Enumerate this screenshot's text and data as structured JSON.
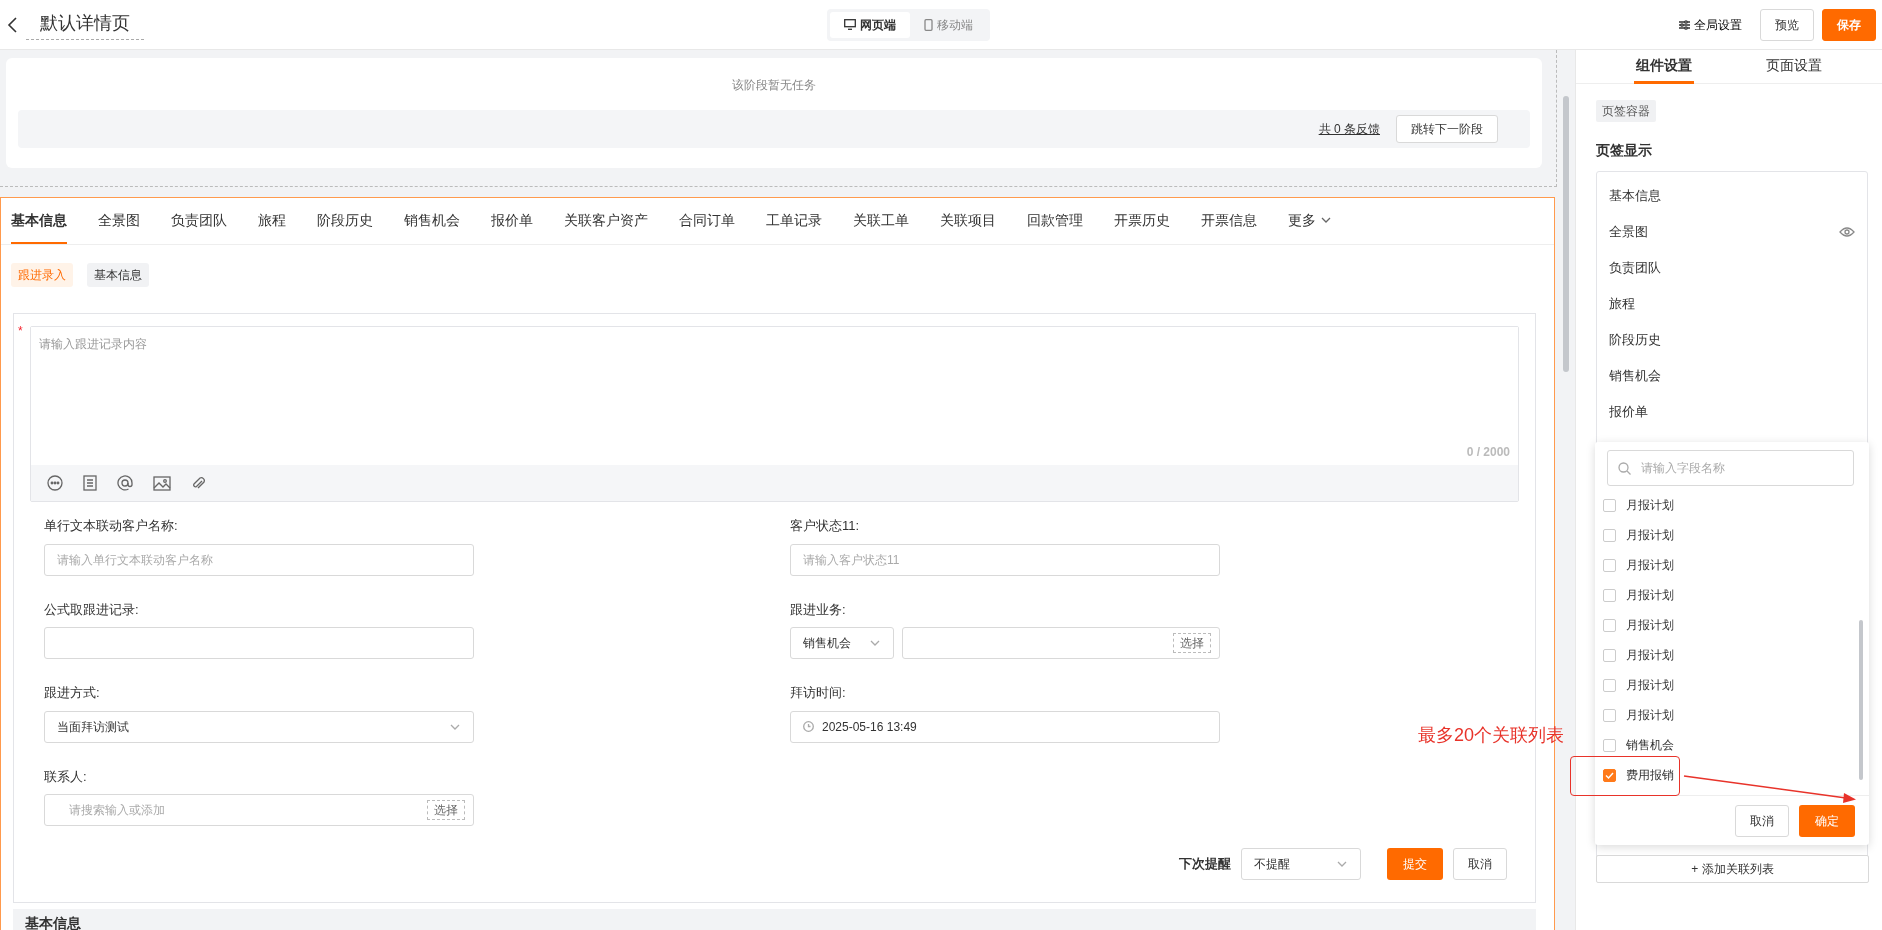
{
  "header": {
    "title": "默认详情页",
    "view_tabs": [
      {
        "label": "网页端",
        "kind": "desktop",
        "selected": true
      },
      {
        "label": "移动端",
        "kind": "mobile",
        "selected": false
      }
    ],
    "global_settings": "全局设置",
    "buttons": [
      {
        "label": "预览",
        "kind": "secondary"
      },
      {
        "label": "保存",
        "kind": "primary"
      }
    ]
  },
  "stage": {
    "empty_text": "该阶段暂无任务",
    "feedback_link": "共 0 条反馈",
    "next_button": "跳转下一阶段"
  },
  "tabs": [
    {
      "label": "基本信息",
      "selected": true
    },
    {
      "label": "全景图",
      "selected": false
    },
    {
      "label": "负责团队",
      "selected": false
    },
    {
      "label": "旅程",
      "selected": false
    },
    {
      "label": "阶段历史",
      "selected": false
    },
    {
      "label": "销售机会",
      "selected": false
    },
    {
      "label": "报价单",
      "selected": false
    },
    {
      "label": "关联客户资产",
      "selected": false
    },
    {
      "label": "合同订单",
      "selected": false
    },
    {
      "label": "工单记录",
      "selected": false
    },
    {
      "label": "关联工单",
      "selected": false
    },
    {
      "label": "关联项目",
      "selected": false
    },
    {
      "label": "回款管理",
      "selected": false
    },
    {
      "label": "开票历史",
      "selected": false
    },
    {
      "label": "开票信息",
      "selected": false
    }
  ],
  "more_tab": "更多",
  "sub_tabs": [
    {
      "label": "跟进录入",
      "selected": true
    },
    {
      "label": "基本信息",
      "selected": false
    }
  ],
  "editor": {
    "required_mark": "*",
    "placeholder": "请输入跟进记录内容",
    "counter": "0 / 2000"
  },
  "fields": [
    {
      "label": "单行文本联动客户名称:",
      "kind": "text",
      "placeholder": "请输入单行文本联动客户名称"
    },
    {
      "label": "客户状态11:",
      "kind": "text",
      "placeholder": "请输入客户状态11"
    },
    {
      "label": "公式取跟进记录:",
      "kind": "text"
    },
    {
      "label": "跟进业务:",
      "kind": "picker",
      "select_value": "销售机会",
      "button": "选择"
    },
    {
      "label": "跟进方式:",
      "kind": "select",
      "value": "当面拜访测试"
    },
    {
      "label": "拜访时间:",
      "kind": "date",
      "value": "2025-05-16 13:49"
    },
    {
      "label": "联系人:",
      "kind": "search",
      "placeholder": "请搜索输入或添加",
      "button": "选择"
    }
  ],
  "footer": {
    "remind_label": "下次提醒",
    "remind_value": "不提醒",
    "submit": "提交",
    "cancel": "取消"
  },
  "section_title": "基本信息",
  "panel": {
    "tabs": [
      {
        "label": "组件设置",
        "selected": true
      },
      {
        "label": "页面设置",
        "selected": false
      }
    ],
    "tag": "页签容器",
    "heading": "页签显示",
    "tab_list": [
      {
        "label": "基本信息",
        "eye": false
      },
      {
        "label": "全景图",
        "eye": true
      },
      {
        "label": "负责团队",
        "eye": false
      },
      {
        "label": "旅程",
        "eye": false
      },
      {
        "label": "阶段历史",
        "eye": false
      },
      {
        "label": "销售机会",
        "eye": false
      },
      {
        "label": "报价单",
        "eye": false
      }
    ],
    "add_button": "+ 添加关联列表"
  },
  "dropdown": {
    "search_placeholder": "请输入字段名称",
    "options": [
      {
        "label": "月报计划",
        "checked": false
      },
      {
        "label": "月报计划",
        "checked": false
      },
      {
        "label": "月报计划",
        "checked": false
      },
      {
        "label": "月报计划",
        "checked": false
      },
      {
        "label": "月报计划",
        "checked": false
      },
      {
        "label": "月报计划",
        "checked": false
      },
      {
        "label": "月报计划",
        "checked": false
      },
      {
        "label": "月报计划",
        "checked": false
      },
      {
        "label": "销售机会",
        "checked": false
      },
      {
        "label": "费用报销",
        "checked": true
      }
    ],
    "cancel": "取消",
    "confirm": "确定"
  },
  "annotation": {
    "text": "最多20个关联列表"
  }
}
